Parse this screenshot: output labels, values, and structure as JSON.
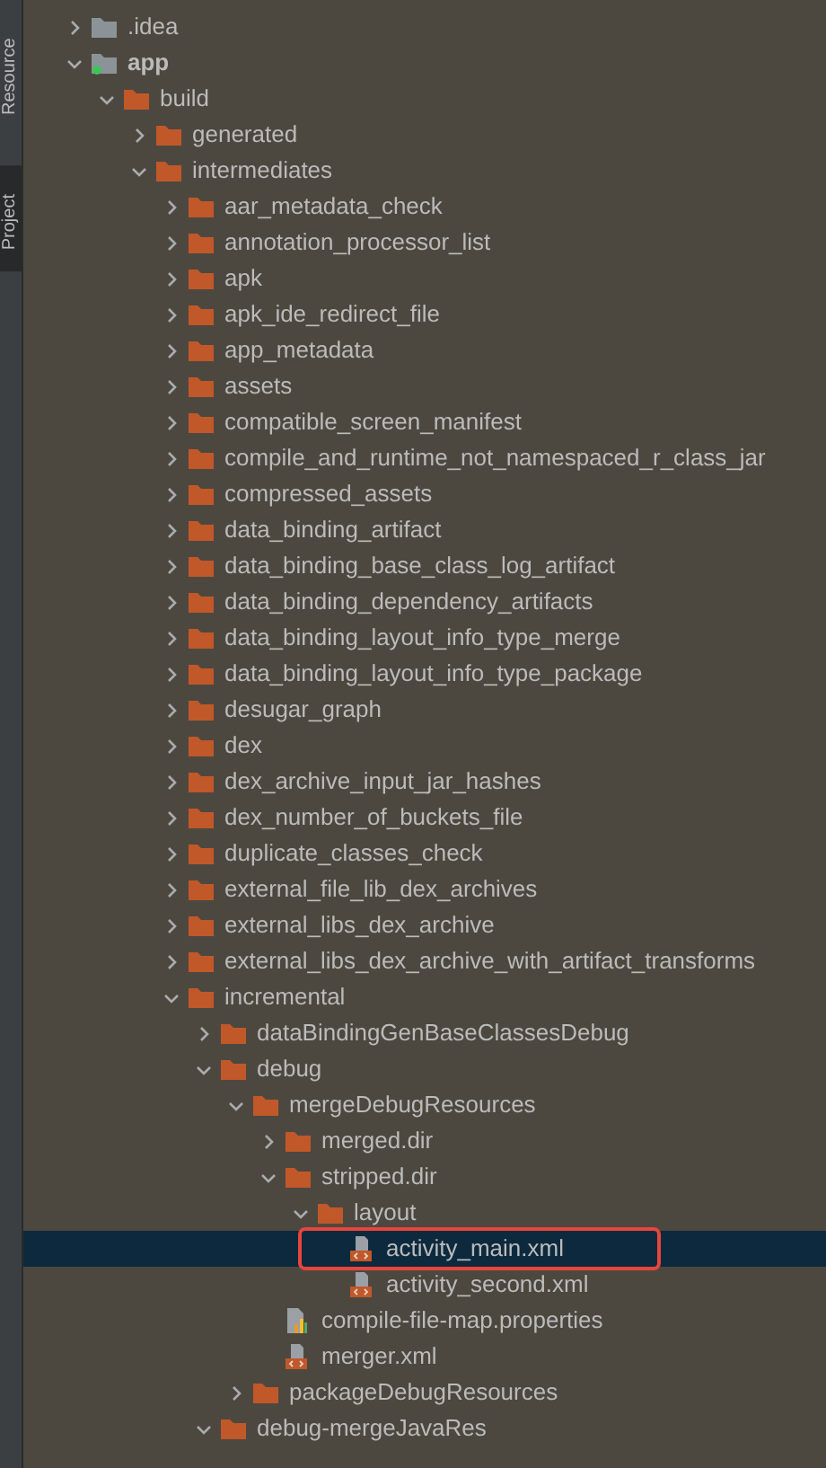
{
  "tool_strip": [
    {
      "label": "Resource",
      "selected": false
    },
    {
      "label": "Project",
      "selected": true
    }
  ],
  "tree": [
    {
      "name": ".idea",
      "kind": "folder",
      "expanded": false,
      "selected": false
    },
    {
      "name": "app",
      "kind": "module",
      "expanded": true,
      "selected": false,
      "children": [
        {
          "name": "build",
          "kind": "excluded-folder",
          "expanded": true,
          "selected": false,
          "children": [
            {
              "name": "generated",
              "kind": "excluded-folder",
              "expanded": false,
              "selected": false
            },
            {
              "name": "intermediates",
              "kind": "excluded-folder",
              "expanded": true,
              "selected": false,
              "children": [
                {
                  "name": "aar_metadata_check",
                  "kind": "excluded-folder",
                  "expanded": false,
                  "selected": false
                },
                {
                  "name": "annotation_processor_list",
                  "kind": "excluded-folder",
                  "expanded": false,
                  "selected": false
                },
                {
                  "name": "apk",
                  "kind": "excluded-folder",
                  "expanded": false,
                  "selected": false
                },
                {
                  "name": "apk_ide_redirect_file",
                  "kind": "excluded-folder",
                  "expanded": false,
                  "selected": false
                },
                {
                  "name": "app_metadata",
                  "kind": "excluded-folder",
                  "expanded": false,
                  "selected": false
                },
                {
                  "name": "assets",
                  "kind": "excluded-folder",
                  "expanded": false,
                  "selected": false
                },
                {
                  "name": "compatible_screen_manifest",
                  "kind": "excluded-folder",
                  "expanded": false,
                  "selected": false
                },
                {
                  "name": "compile_and_runtime_not_namespaced_r_class_jar",
                  "kind": "excluded-folder",
                  "expanded": false,
                  "selected": false
                },
                {
                  "name": "compressed_assets",
                  "kind": "excluded-folder",
                  "expanded": false,
                  "selected": false
                },
                {
                  "name": "data_binding_artifact",
                  "kind": "excluded-folder",
                  "expanded": false,
                  "selected": false
                },
                {
                  "name": "data_binding_base_class_log_artifact",
                  "kind": "excluded-folder",
                  "expanded": false,
                  "selected": false
                },
                {
                  "name": "data_binding_dependency_artifacts",
                  "kind": "excluded-folder",
                  "expanded": false,
                  "selected": false
                },
                {
                  "name": "data_binding_layout_info_type_merge",
                  "kind": "excluded-folder",
                  "expanded": false,
                  "selected": false
                },
                {
                  "name": "data_binding_layout_info_type_package",
                  "kind": "excluded-folder",
                  "expanded": false,
                  "selected": false
                },
                {
                  "name": "desugar_graph",
                  "kind": "excluded-folder",
                  "expanded": false,
                  "selected": false
                },
                {
                  "name": "dex",
                  "kind": "excluded-folder",
                  "expanded": false,
                  "selected": false
                },
                {
                  "name": "dex_archive_input_jar_hashes",
                  "kind": "excluded-folder",
                  "expanded": false,
                  "selected": false
                },
                {
                  "name": "dex_number_of_buckets_file",
                  "kind": "excluded-folder",
                  "expanded": false,
                  "selected": false
                },
                {
                  "name": "duplicate_classes_check",
                  "kind": "excluded-folder",
                  "expanded": false,
                  "selected": false
                },
                {
                  "name": "external_file_lib_dex_archives",
                  "kind": "excluded-folder",
                  "expanded": false,
                  "selected": false
                },
                {
                  "name": "external_libs_dex_archive",
                  "kind": "excluded-folder",
                  "expanded": false,
                  "selected": false
                },
                {
                  "name": "external_libs_dex_archive_with_artifact_transforms",
                  "kind": "excluded-folder",
                  "expanded": false,
                  "selected": false
                },
                {
                  "name": "incremental",
                  "kind": "excluded-folder",
                  "expanded": true,
                  "selected": false,
                  "children": [
                    {
                      "name": "dataBindingGenBaseClassesDebug",
                      "kind": "excluded-folder",
                      "expanded": false,
                      "selected": false
                    },
                    {
                      "name": "debug",
                      "kind": "excluded-folder",
                      "expanded": true,
                      "selected": false,
                      "children": [
                        {
                          "name": "mergeDebugResources",
                          "kind": "excluded-folder",
                          "expanded": true,
                          "selected": false,
                          "children": [
                            {
                              "name": "merged.dir",
                              "kind": "excluded-folder",
                              "expanded": false,
                              "selected": false
                            },
                            {
                              "name": "stripped.dir",
                              "kind": "excluded-folder",
                              "expanded": true,
                              "selected": false,
                              "children": [
                                {
                                  "name": "layout",
                                  "kind": "excluded-folder",
                                  "expanded": true,
                                  "selected": false,
                                  "children": [
                                    {
                                      "name": "activity_main.xml",
                                      "kind": "xml-file",
                                      "selected": true,
                                      "annotated": true
                                    },
                                    {
                                      "name": "activity_second.xml",
                                      "kind": "xml-file",
                                      "selected": false
                                    }
                                  ]
                                }
                              ]
                            },
                            {
                              "name": "compile-file-map.properties",
                              "kind": "properties-file",
                              "selected": false
                            },
                            {
                              "name": "merger.xml",
                              "kind": "xml-file",
                              "selected": false
                            }
                          ]
                        },
                        {
                          "name": "packageDebugResources",
                          "kind": "excluded-folder",
                          "expanded": false,
                          "selected": false
                        }
                      ]
                    },
                    {
                      "name": "debug-mergeJavaRes",
                      "kind": "excluded-folder",
                      "expanded": true,
                      "selected": false
                    }
                  ]
                }
              ]
            }
          ]
        }
      ]
    }
  ]
}
